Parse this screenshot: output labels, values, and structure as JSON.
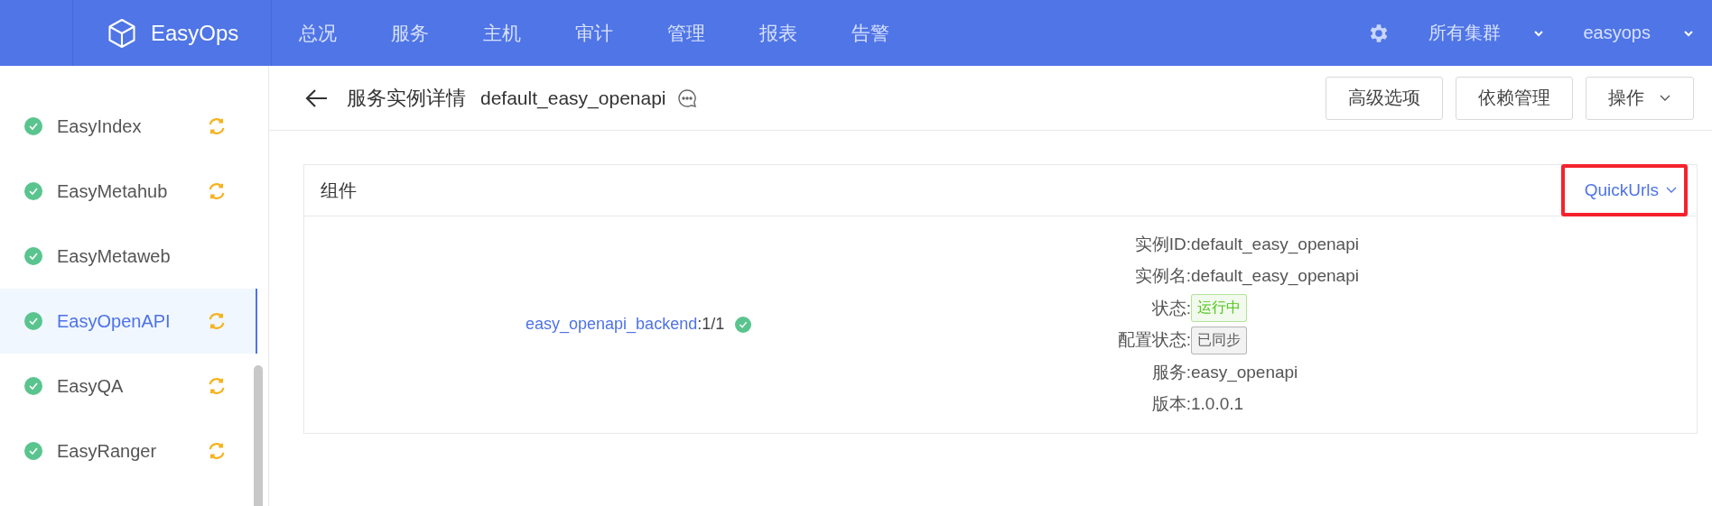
{
  "topbar": {
    "brand": "EasyOps",
    "nav": [
      {
        "label": "总况",
        "selected": false
      },
      {
        "label": "服务",
        "selected": false
      },
      {
        "label": "主机",
        "selected": false
      },
      {
        "label": "审计",
        "selected": false
      },
      {
        "label": "管理",
        "selected": false
      },
      {
        "label": "报表",
        "selected": false
      },
      {
        "label": "告警",
        "selected": false
      }
    ],
    "cluster": "所有集群",
    "user": "easyops"
  },
  "sidebar": {
    "items": [
      {
        "label": "EasyIndex",
        "selected": false,
        "syncing": true
      },
      {
        "label": "EasyMetahub",
        "selected": false,
        "syncing": true
      },
      {
        "label": "EasyMetaweb",
        "selected": false,
        "syncing": false
      },
      {
        "label": "EasyOpenAPI",
        "selected": true,
        "syncing": true
      },
      {
        "label": "EasyQA",
        "selected": false,
        "syncing": true
      },
      {
        "label": "EasyRanger",
        "selected": false,
        "syncing": true
      }
    ]
  },
  "header": {
    "title": "服务实例详情",
    "instance": "default_easy_openapi",
    "buttons": [
      {
        "label": "高级选项",
        "dropdown": false
      },
      {
        "label": "依赖管理",
        "dropdown": false
      },
      {
        "label": "操作",
        "dropdown": true
      }
    ]
  },
  "card": {
    "title": "组件",
    "quick_urls": {
      "label": "QuickUrls",
      "highlighted": true
    },
    "component": {
      "name": "easy_openapi_backend",
      "count": ":1/1",
      "healthy": true
    },
    "details": [
      {
        "label": "实例ID:",
        "value": "default_easy_openapi",
        "kind": "text"
      },
      {
        "label": "实例名:",
        "value": "default_easy_openapi",
        "kind": "text"
      },
      {
        "label": "状态:",
        "value": "运行中",
        "kind": "tag",
        "color": "#52c41a"
      },
      {
        "label": "配置状态:",
        "value": "已同步",
        "kind": "tag",
        "color": "#595959"
      },
      {
        "label": "服务:",
        "value": "easy_openapi",
        "kind": "text"
      },
      {
        "label": "版本:",
        "value": "1.0.0.1",
        "kind": "text"
      }
    ]
  }
}
